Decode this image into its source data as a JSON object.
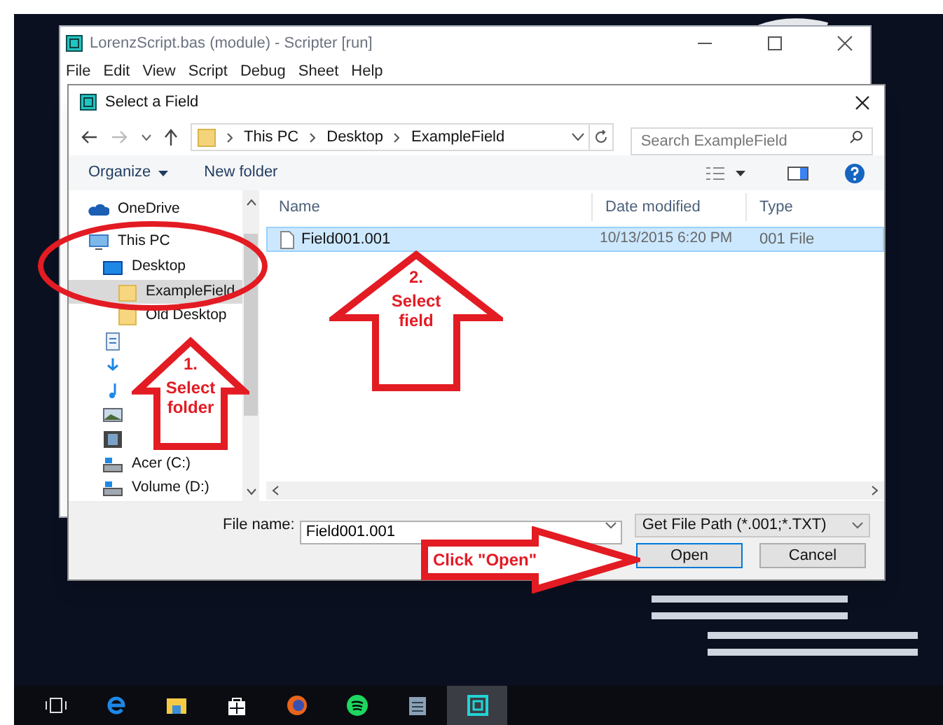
{
  "scripter_window": {
    "title": "LorenzScript.bas (module) - Scripter [run]",
    "menu": [
      "File",
      "Edit",
      "View",
      "Script",
      "Debug",
      "Sheet",
      "Help"
    ]
  },
  "dialog": {
    "title": "Select a Field",
    "address": [
      "This PC",
      "Desktop",
      "ExampleField"
    ],
    "search": {
      "placeholder": "Search ExampleField"
    },
    "toolbar": [
      "Organize",
      "New folder"
    ],
    "nav_tree": [
      {
        "kind": "cloud",
        "label": "OneDrive",
        "selected": false
      },
      {
        "kind": "pc",
        "label": "This PC",
        "selected": false,
        "children": [
          {
            "kind": "desktop",
            "label": "Desktop",
            "selected": false,
            "children": [
              {
                "kind": "folder",
                "label": "ExampleField",
                "selected": true
              },
              {
                "kind": "folder",
                "label": "Old Desktop",
                "selected": false
              }
            ]
          },
          {
            "kind": "documents",
            "selected": false
          },
          {
            "kind": "downloads",
            "selected": false
          },
          {
            "kind": "music",
            "selected": false
          },
          {
            "kind": "pictures",
            "selected": false
          },
          {
            "kind": "videos",
            "selected": false
          },
          {
            "kind": "drive",
            "label": "Acer (C:)",
            "selected": false
          },
          {
            "kind": "drive",
            "label": "Volume (D:)",
            "selected": false
          }
        ]
      }
    ],
    "columns": [
      "Name",
      "Date modified",
      "Type"
    ],
    "files": [
      {
        "name": "Field001.001",
        "date": "10/13/2015 6:20 PM",
        "type": "001 File",
        "selected": true
      }
    ],
    "file_name_label": "File name:",
    "file_name": "Field001.001",
    "filter": "Get File Path (*.001;*.TXT)",
    "buttons": [
      {
        "label": "Open",
        "default": true
      },
      {
        "label": "Cancel",
        "default": false
      }
    ]
  },
  "annotations": [
    {
      "kind": "ellipse"
    },
    {
      "kind": "up_arrow",
      "step": "1.",
      "text": "Select folder"
    },
    {
      "kind": "up_arrow",
      "step": "2.",
      "text": "Select field"
    },
    {
      "kind": "right_arrow",
      "text": "Click \"Open\""
    }
  ],
  "taskbar": [
    {
      "kind": "task_view",
      "active": false
    },
    {
      "kind": "browser_e",
      "active": false
    },
    {
      "kind": "folder",
      "active": false
    },
    {
      "kind": "store",
      "active": false
    },
    {
      "kind": "fox",
      "active": false
    },
    {
      "kind": "music",
      "active": false
    },
    {
      "kind": "notes",
      "active": false
    },
    {
      "kind": "app",
      "active": true
    }
  ]
}
